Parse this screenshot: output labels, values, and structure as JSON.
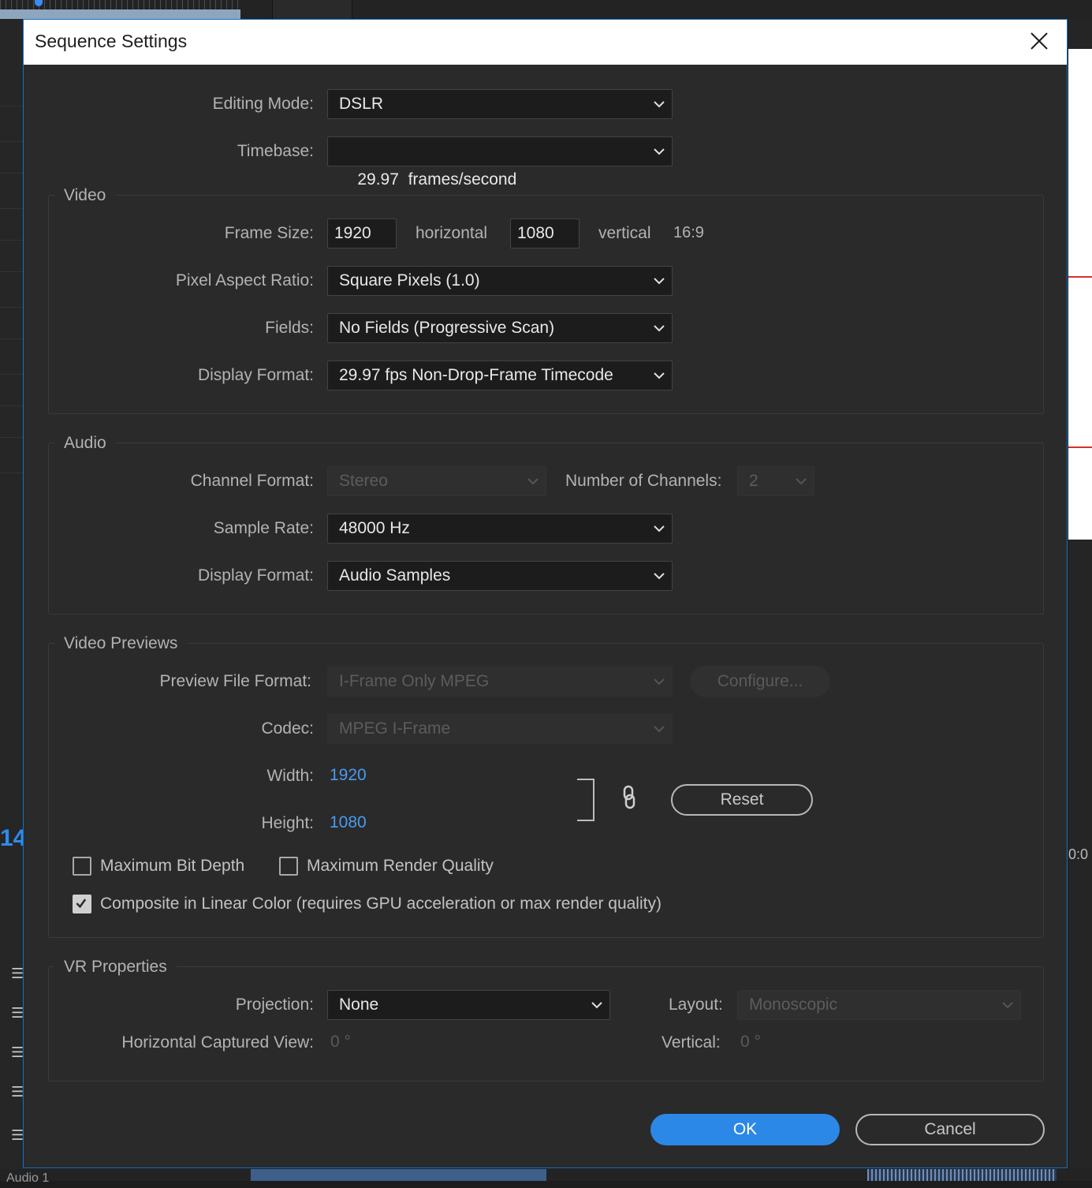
{
  "dialog": {
    "title": "Sequence Settings",
    "editing_mode": {
      "label": "Editing Mode:",
      "value": "DSLR"
    },
    "timebase": {
      "label": "Timebase:",
      "value": "29.97  frames/second"
    },
    "video": {
      "title": "Video",
      "frame_size": {
        "label": "Frame Size:",
        "width": "1920",
        "horizontal": "horizontal",
        "height": "1080",
        "vertical": "vertical",
        "aspect": "16:9"
      },
      "pixel_aspect_ratio": {
        "label": "Pixel Aspect Ratio:",
        "value": "Square Pixels (1.0)"
      },
      "fields": {
        "label": "Fields:",
        "value": "No Fields (Progressive Scan)"
      },
      "display_format": {
        "label": "Display Format:",
        "value": "29.97 fps Non-Drop-Frame Timecode"
      }
    },
    "audio": {
      "title": "Audio",
      "channel_format": {
        "label": "Channel Format:",
        "value": "Stereo"
      },
      "number_of_channels": {
        "label": "Number of Channels:",
        "value": "2"
      },
      "sample_rate": {
        "label": "Sample Rate:",
        "value": "48000 Hz"
      },
      "display_format": {
        "label": "Display Format:",
        "value": "Audio Samples"
      }
    },
    "video_previews": {
      "title": "Video Previews",
      "preview_file_format": {
        "label": "Preview File Format:",
        "value": "I-Frame Only MPEG"
      },
      "configure_label": "Configure...",
      "codec": {
        "label": "Codec:",
        "value": "MPEG I-Frame"
      },
      "width": {
        "label": "Width:",
        "value": "1920"
      },
      "height": {
        "label": "Height:",
        "value": "1080"
      },
      "reset_label": "Reset",
      "max_bit_depth": {
        "label": "Maximum Bit Depth",
        "checked": false
      },
      "max_render_quality": {
        "label": "Maximum Render Quality",
        "checked": false
      },
      "composite_linear": {
        "label": "Composite in Linear Color (requires GPU acceleration or max render quality)",
        "checked": true
      }
    },
    "vr_properties": {
      "title": "VR Properties",
      "projection": {
        "label": "Projection:",
        "value": "None"
      },
      "layout": {
        "label": "Layout:",
        "value": "Monoscopic"
      },
      "horizontal_captured_view": {
        "label": "Horizontal Captured View:",
        "value": "0 °"
      },
      "vertical": {
        "label": "Vertical:",
        "value": "0 °"
      }
    },
    "ok_label": "OK",
    "cancel_label": "Cancel"
  },
  "background": {
    "timecode_fragment": "14",
    "timecode_fragment_right": "0:0",
    "audio_track_label": "Audio 1"
  },
  "colors": {
    "accent_blue": "#2b88e6",
    "link_blue": "#4a9af0",
    "dialog_bg": "#2a2a2a",
    "titlebar_bg": "#ffffff"
  }
}
